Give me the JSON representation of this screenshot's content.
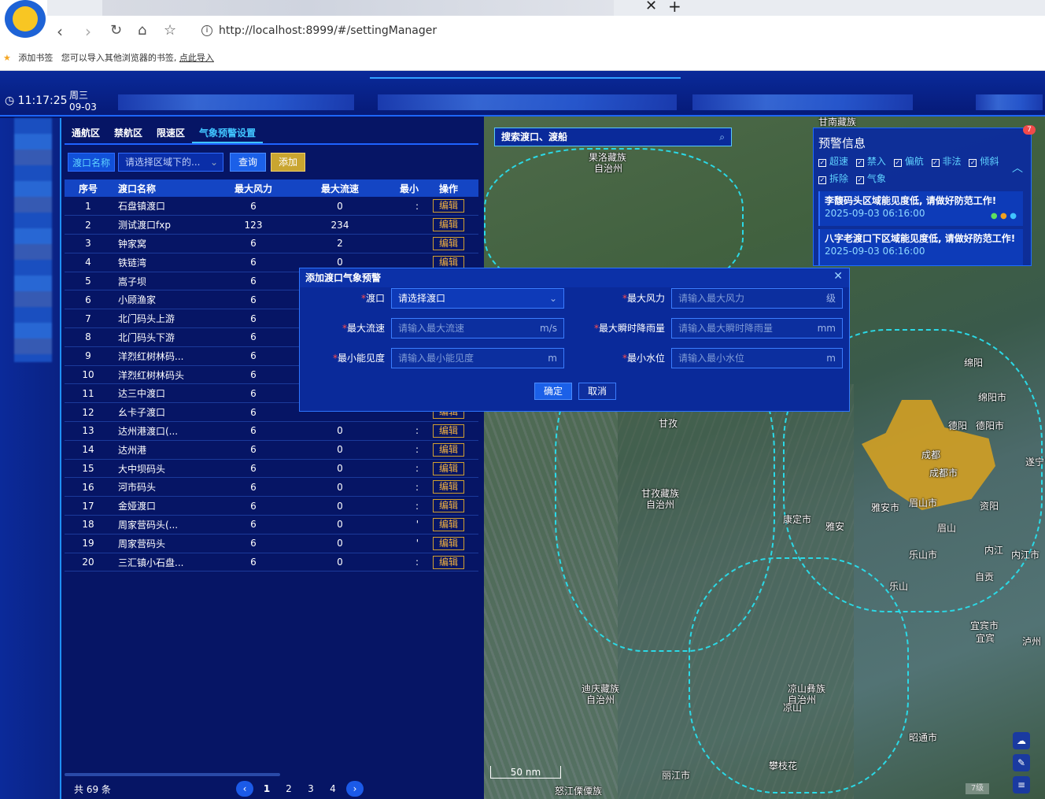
{
  "browser": {
    "url": "http://localhost:8999/#/settingManager",
    "bookmarks_text": "添加书签",
    "bookmarks_hint": "您可以导入其他浏览器的书签,",
    "bookmarks_link": "点此导入"
  },
  "header": {
    "time": "11:17:25",
    "weekday": "周三",
    "date": "09-03"
  },
  "tabs": [
    "通航区",
    "禁航区",
    "限速区",
    "气象预警设置"
  ],
  "filter": {
    "label": "渡口名称",
    "placeholder": "请选择区域下的...",
    "query": "查询",
    "add": "添加"
  },
  "table": {
    "headers": [
      "序号",
      "渡口名称",
      "最大风力",
      "最大流速",
      "最小",
      "操作"
    ],
    "edit_label": "编辑",
    "rows": [
      [
        "1",
        "石盘镇渡口",
        "6",
        "0",
        ":"
      ],
      [
        "2",
        "测试渡口fxp",
        "123",
        "234",
        ""
      ],
      [
        "3",
        "钟家窝",
        "6",
        "2",
        ""
      ],
      [
        "4",
        "铁链湾",
        "6",
        "0",
        ""
      ],
      [
        "5",
        "嵩子坝",
        "6",
        "",
        ""
      ],
      [
        "6",
        "小顾渔家",
        "6",
        "",
        ""
      ],
      [
        "7",
        "北门码头上游",
        "6",
        "",
        ""
      ],
      [
        "8",
        "北门码头下游",
        "6",
        "",
        ""
      ],
      [
        "9",
        "洋烈红树林码...",
        "6",
        "",
        ""
      ],
      [
        "10",
        "洋烈红树林码头",
        "6",
        "",
        ""
      ],
      [
        "11",
        "达三中渡口",
        "6",
        "",
        ""
      ],
      [
        "12",
        "幺卡子渡口",
        "6",
        "",
        ""
      ],
      [
        "13",
        "达州港渡口(...",
        "6",
        "0",
        ":"
      ],
      [
        "14",
        "达州港",
        "6",
        "0",
        ":"
      ],
      [
        "15",
        "大中坝码头",
        "6",
        "0",
        ":"
      ],
      [
        "16",
        "河市码头",
        "6",
        "0",
        ":"
      ],
      [
        "17",
        "金娅渡口",
        "6",
        "0",
        ":"
      ],
      [
        "18",
        "周家营码头(...",
        "6",
        "0",
        "'"
      ],
      [
        "19",
        "周家营码头",
        "6",
        "0",
        "'"
      ],
      [
        "20",
        "三汇镇小石盘...",
        "6",
        "0",
        ":"
      ]
    ]
  },
  "pager": {
    "total": "共 69 条",
    "pages": [
      "1",
      "2",
      "3",
      "4"
    ],
    "prev": "‹",
    "next": "›"
  },
  "map": {
    "search": "搜索渡口、渡船",
    "labels": [
      "甘南藏族",
      "果洛藏族",
      "自治州",
      "甘孜",
      "甘孜藏族",
      "自治州",
      "绵阳",
      "绵阳市",
      "德阳",
      "德阳市",
      "成都",
      "成都市",
      "遂宁",
      "雅安市",
      "眉山市",
      "资阳",
      "康定市",
      "雅安",
      "眉山",
      "内江",
      "内江市",
      "乐山市",
      "乐山",
      "自贡",
      "宜宾市",
      "宜宾",
      "泸州",
      "迪庆藏族",
      "自治州",
      "凉山彝族",
      "自治州",
      "凉山",
      "昭通市",
      "攀枝花",
      "丽江市",
      "怒江傈僳族"
    ],
    "scale": "50 nm",
    "zoom": "7级"
  },
  "warn": {
    "badge": "7",
    "title": "预警信息",
    "filters": [
      "超速",
      "禁入",
      "偏航",
      "非法",
      "倾斜",
      "拆除",
      "气象"
    ],
    "items": [
      {
        "text": "李馥码头区域能见度低, 请做好防范工作!",
        "date": "2025-09-03 06:16:00"
      },
      {
        "text": "八字老渡口下区域能见度低, 请做好防范工作!",
        "date": "2025-09-03 06:16:00"
      }
    ]
  },
  "modal": {
    "title": "添加渡口气象预警",
    "fields": [
      {
        "label": "渡口",
        "placeholder": "请选择渡口",
        "unit": ""
      },
      {
        "label": "最大风力",
        "placeholder": "请输入最大风力",
        "unit": "级"
      },
      {
        "label": "最大流速",
        "placeholder": "请输入最大流速",
        "unit": "m/s"
      },
      {
        "label": "最大瞬时降雨量",
        "placeholder": "请输入最大瞬时降雨量",
        "unit": "mm"
      },
      {
        "label": "最小能见度",
        "placeholder": "请输入最小能见度",
        "unit": "m"
      },
      {
        "label": "最小水位",
        "placeholder": "请输入最小水位",
        "unit": "m"
      }
    ],
    "confirm": "确定",
    "cancel": "取消"
  }
}
